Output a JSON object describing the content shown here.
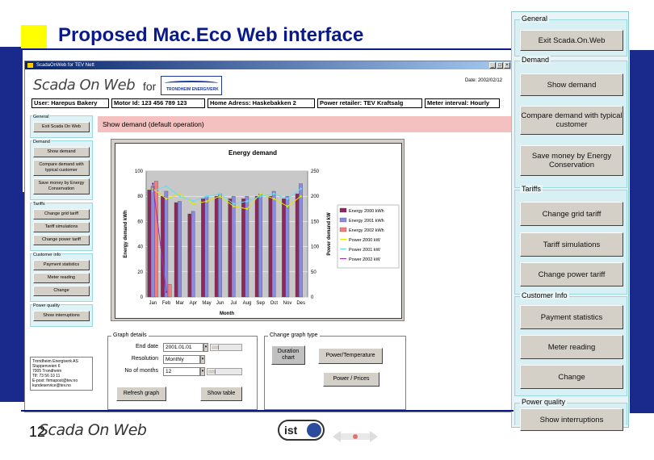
{
  "slide": {
    "title": "Proposed Mac.Eco Web interface",
    "page_number": "12",
    "footer_logo": "Scada On Web",
    "ist_logo": "ist"
  },
  "window": {
    "title": "ScadaOnWeb for TEV Nett"
  },
  "app": {
    "logo": "Scada On Web",
    "for_label": "for",
    "partner_logo": "TRONDHEIM ENERGIVERK",
    "date": "Date: 2002/02/12",
    "info": {
      "user": "User: Harepus Bakery",
      "motor_id": "Motor Id: 123 456 789 123",
      "home_address": "Home Adress: Haskebakken 2",
      "power_retailer": "Power retailer: TEV Kraftsalg",
      "meter_interval": "Meter interval: Hourly"
    },
    "nav": {
      "groups": [
        {
          "caption": "General",
          "buttons": [
            "Exit Scada On Web"
          ]
        },
        {
          "caption": "Demand",
          "buttons": [
            "Show demand",
            "Compare demand with typical customer",
            "Save money by Energy Conservation"
          ]
        },
        {
          "caption": "Tariffs",
          "buttons": [
            "Change grid tariff",
            "Tariff simulations",
            "Change power tariff"
          ]
        },
        {
          "caption": "Customer info",
          "buttons": [
            "Payment statistics",
            "Meter reading",
            "Change"
          ]
        },
        {
          "caption": "Power quality",
          "buttons": [
            "Show interruptions"
          ]
        }
      ]
    },
    "contact": {
      "lines": [
        "Trondheim Energiverk AS",
        "Sluppenveien 6",
        "7005 Trondheim",
        "Tlf: 73 56 10 11",
        "E-post: firmapost@tev.no",
        "kundeservice@tev.no"
      ]
    },
    "header": "Show demand (default operation)",
    "graph_details": {
      "caption": "Graph details",
      "end_date_label": "End date",
      "end_date": "2001.01.01",
      "resolution_label": "Resolution",
      "resolution": "Monthly",
      "months_label": "No of months",
      "months": "12",
      "refresh_button": "Refresh graph",
      "table_button": "Show table"
    },
    "change_graph_type": {
      "caption": "Change graph type",
      "duration_button": "Duration chart",
      "power_temp_button": "Power/Temperature",
      "power_prices_button": "Power / Prices"
    }
  },
  "right_panel": {
    "groups": [
      {
        "caption": "General",
        "buttons": [
          "Exit Scada.On.Web"
        ]
      },
      {
        "caption": "Demand",
        "buttons": [
          "Show demand",
          "Compare demand with typical customer",
          "Save money by Energy Conservation"
        ]
      },
      {
        "caption": "Tariffs",
        "buttons": [
          "Change grid tariff",
          "Tariff simulations",
          "Change power tariff"
        ]
      },
      {
        "caption": "Customer Info",
        "buttons": [
          "Payment statistics",
          "Meter reading",
          "Change"
        ]
      },
      {
        "caption": "Power quality",
        "buttons": [
          "Show interruptions"
        ]
      }
    ]
  },
  "colors": {
    "slide_blue": "#1a2a8c",
    "yellow": "#ffff00",
    "pink": "#f5c0c0",
    "panel_cyan": "#d8f0f4"
  },
  "chart_data": {
    "type": "bar",
    "title": "Energy demand",
    "xlabel": "Month",
    "ylabel": "Energy demand kWh",
    "y2label": "Power demand kW",
    "categories": [
      "Jan",
      "Feb",
      "Mar",
      "Apr",
      "May",
      "Jun",
      "Jul",
      "Aug",
      "Sep",
      "Oct",
      "Nov",
      "Des"
    ],
    "ylim": [
      0,
      100
    ],
    "y2lim": [
      0,
      250
    ],
    "yticks": [
      "100",
      "80",
      "60",
      "40",
      "20",
      "0"
    ],
    "y2ticks": [
      "250",
      "200",
      "150",
      "100",
      "50",
      "0"
    ],
    "series": [
      {
        "name": "Energy 2000 kWh",
        "kind": "bar",
        "color": "#8b2a5a",
        "values": [
          85,
          80,
          75,
          66,
          78,
          80,
          78,
          78,
          80,
          80,
          78,
          82
        ]
      },
      {
        "name": "Energy 2001 kWh",
        "kind": "bar",
        "color": "#8a8ae0",
        "values": [
          88,
          84,
          76,
          68,
          80,
          82,
          80,
          80,
          82,
          84,
          80,
          90
        ]
      },
      {
        "name": "Energy 2002 kWh",
        "kind": "bar",
        "color": "#f08080",
        "values": [
          92,
          10,
          0,
          0,
          0,
          0,
          0,
          0,
          0,
          0,
          0,
          0
        ]
      },
      {
        "name": "Power 2000 kW",
        "kind": "line",
        "color": "#e6e600",
        "values": [
          215,
          195,
          205,
          185,
          190,
          200,
          180,
          175,
          205,
          195,
          180,
          200
        ]
      },
      {
        "name": "Power 2001 kW",
        "kind": "line",
        "color": "#66ddee",
        "values": [
          210,
          220,
          200,
          190,
          200,
          205,
          185,
          190,
          200,
          205,
          195,
          215
        ]
      },
      {
        "name": "Power 2002 kW",
        "kind": "line",
        "color": "#9933aa",
        "values": [
          225,
          10
        ]
      }
    ]
  }
}
